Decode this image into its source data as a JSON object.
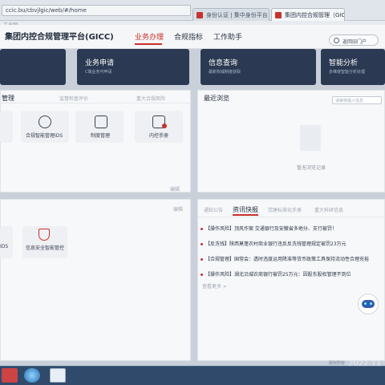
{
  "browser": {
    "address": "ccic.bu/cbvjlgic/web/#/home",
    "tabs": [
      {
        "label": "身份认证 | 集中身份平台",
        "active": false
      },
      {
        "label": "集团内控合规管理（GICC）",
        "active": true
      }
    ],
    "toolbar_label": "工业网"
  },
  "header": {
    "app_title": "集团内控合规管理平台(GICC)",
    "nav": [
      {
        "label": "业务办理",
        "active": true
      },
      {
        "label": "合规指标",
        "active": false
      },
      {
        "label": "工作助手",
        "active": false
      }
    ],
    "back_button": "返回旧门户"
  },
  "cards": [
    {
      "title": "",
      "subtitle": ""
    },
    {
      "title": "业务申请",
      "subtitle": "C端业务可申请"
    },
    {
      "title": "信息查询",
      "subtitle": "最新权威制度获取"
    },
    {
      "title": "智能分析",
      "subtitle": "多维度智能分析处理"
    }
  ],
  "quick_panel": {
    "title": "管理",
    "tabs": [
      "监督检查评价",
      "重大合规风险"
    ],
    "items": [
      {
        "label": "",
        "icon": "doc-icon"
      },
      {
        "label": "合规智能管理IDS",
        "icon": "globe-icon"
      },
      {
        "label": "制度管理",
        "icon": "document-icon"
      },
      {
        "label": "内控手册",
        "icon": "manual-icon"
      }
    ],
    "more": "编辑"
  },
  "recent_panel": {
    "title": "最近浏览",
    "search_placeholder": "请审核输入信息",
    "empty_text": "暂无浏览记录"
  },
  "bottom_left_panel": {
    "more": "编辑",
    "items": [
      {
        "label": "IDS",
        "icon": "app-icon"
      },
      {
        "label": "信息安全智能管控",
        "icon": "shield-icon"
      }
    ]
  },
  "news_panel": {
    "tabs": [
      {
        "label": "通知公告",
        "active": false
      },
      {
        "label": "资讯快报",
        "active": true
      },
      {
        "label": "党建标准化手册",
        "active": false
      },
      {
        "label": "重大科研信息",
        "active": false
      }
    ],
    "items": [
      "【操作风险】顶风作案 交通银行及安徽省多地分、支行被罚！",
      "【反洗钱】陕西莫蓬农村商业银行违反反洗钱管理规定被罚23万元",
      "【合规管理】国常会：透时违度运用降准等货币政策工具保持流动性合理充裕",
      "【操作风险】湖北沿城农商银行被罚25万元：因股东股权管理不到位"
    ],
    "more": "查看更多 >"
  },
  "taskbar": {
    "clock": "2022.11",
    "small": "版权所有"
  },
  "colors": {
    "accent": "#c9302c",
    "card": "#2b3a52",
    "taskbar": "#2f4a6b"
  }
}
